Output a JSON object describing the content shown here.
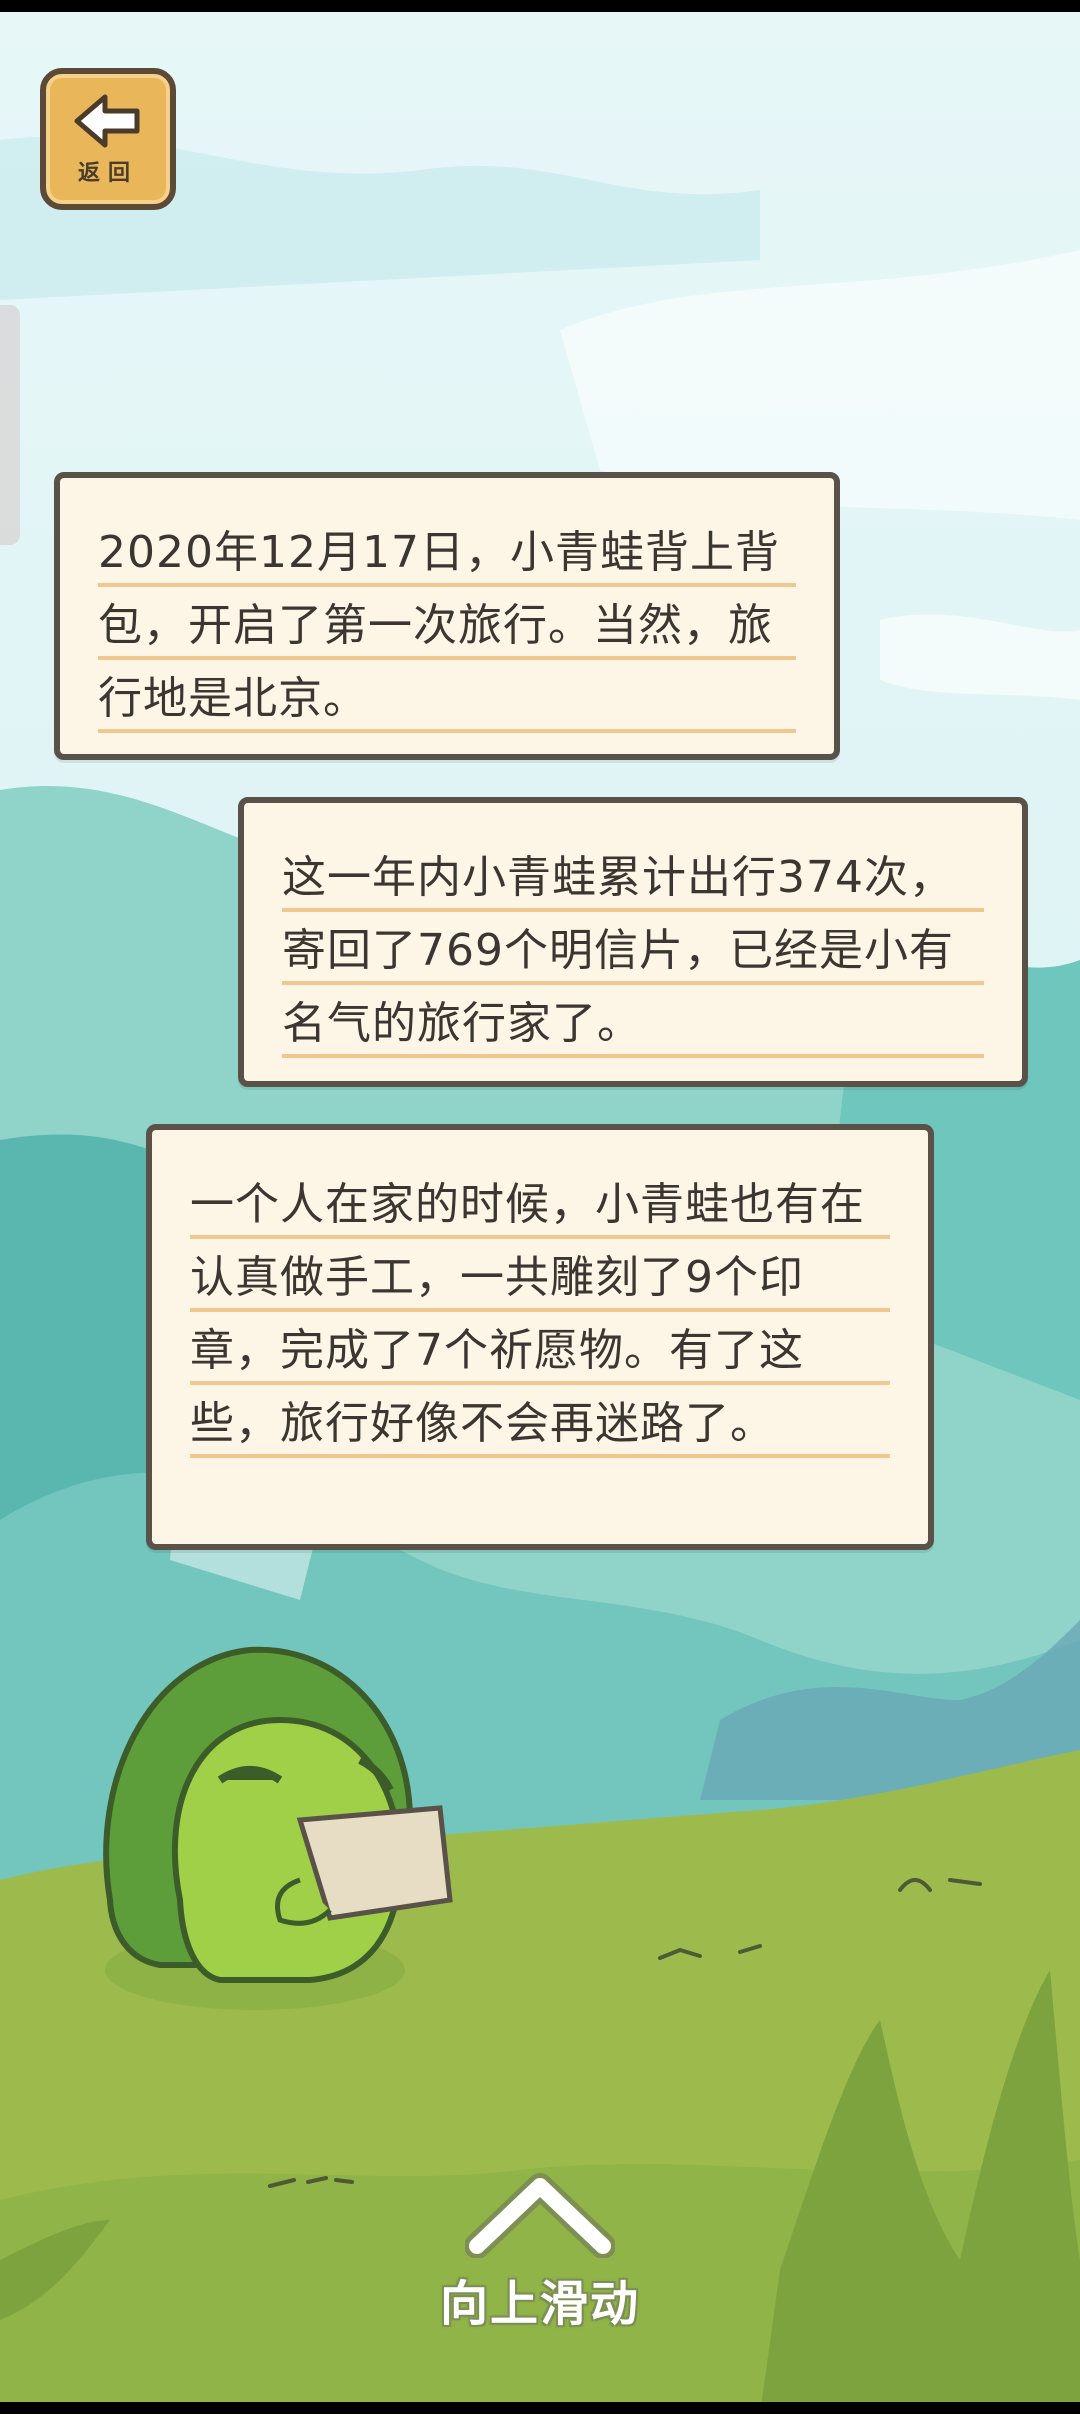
{
  "back_button": {
    "label": "返回",
    "icon": "arrow-left-icon"
  },
  "messages": [
    {
      "text": "2020年12月17日，小青蛙背上背包，开启了第一次旅行。当然，旅行地是北京。"
    },
    {
      "text": "这一年内小青蛙累计出行374次，寄回了769个明信片，已经是小有名气的旅行家了。"
    },
    {
      "text": "一个人在家的时候，小青蛙也有在认真做手工，一共雕刻了9个印章，完成了7个祈愿物。有了这些，旅行好像不会再迷路了。"
    }
  ],
  "swipe_hint": {
    "label": "向上滑动",
    "icon": "chevron-up-icon"
  },
  "colors": {
    "sky": "#d8f0f3",
    "mountain": "#6fc7be",
    "grass": "#9dbb4d",
    "bubble_bg": "#fdf6e6",
    "bubble_border": "#5a5149",
    "underline": "#f0c88f",
    "frog": "#8cc43e"
  }
}
